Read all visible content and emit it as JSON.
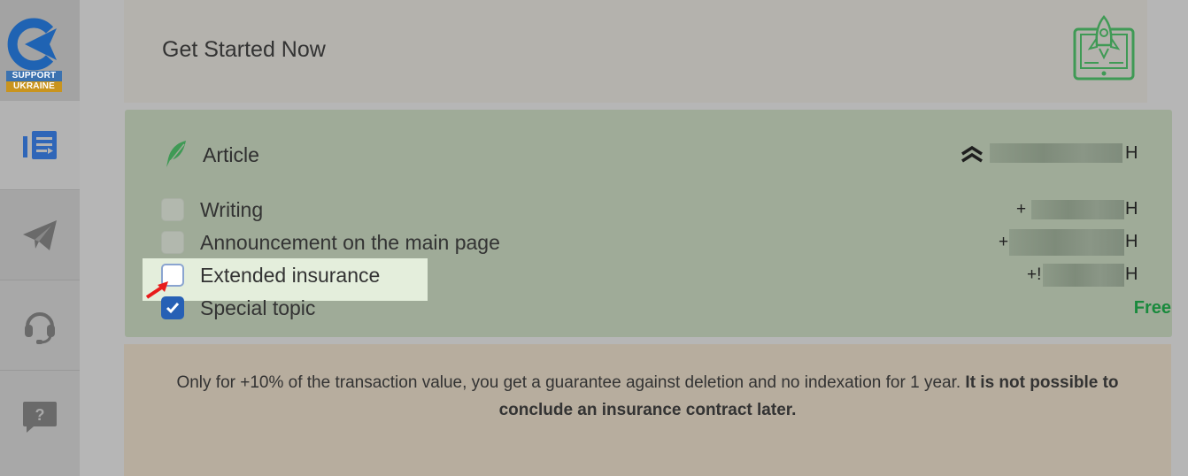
{
  "logo": {
    "line1": "SUPPORT",
    "line2": "UKRAINE"
  },
  "sidebar": {
    "items": [
      {
        "icon": "article-list-icon",
        "active": true
      },
      {
        "icon": "paper-plane-icon"
      },
      {
        "icon": "headset-icon"
      },
      {
        "icon": "help-question-icon",
        "glyph": "?"
      }
    ]
  },
  "header": {
    "title": "Get Started Now",
    "icon": "rocket-laptop-icon"
  },
  "article": {
    "title": "Article",
    "currency": "H",
    "options": [
      {
        "label": "Writing",
        "checked": false,
        "prefix": "+",
        "currency": "H"
      },
      {
        "label": "Announcement on the main page",
        "checked": false,
        "prefix": "+",
        "currency": "H"
      },
      {
        "label": "Extended insurance",
        "checked": false,
        "prefix": "+!",
        "currency": "H",
        "highlighted": true
      },
      {
        "label": "Special topic",
        "checked": true,
        "price": "Free"
      }
    ]
  },
  "info": {
    "text": "Only for +10% of the transaction value, you get a guarantee against deletion and no indexation for 1 year. ",
    "bold": "It is not possible to conclude an insurance contract later."
  },
  "colors": {
    "accent": "#2760b5",
    "free": "#1a8a3d",
    "highlight": "#e4eedc"
  }
}
